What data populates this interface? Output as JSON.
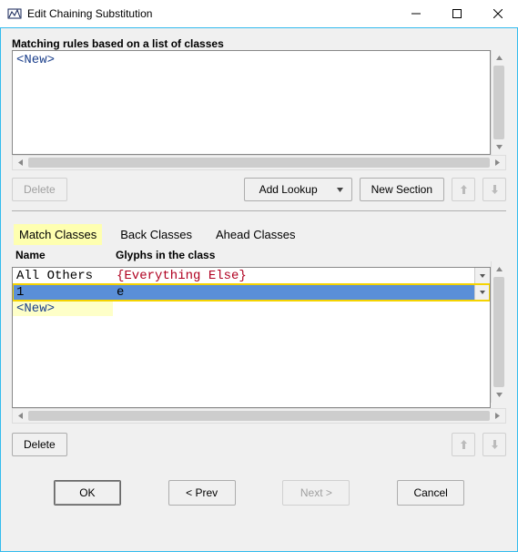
{
  "window": {
    "title": "Edit Chaining Substitution"
  },
  "rules": {
    "label": "Matching rules based on a list of classes",
    "new_placeholder": "<New>"
  },
  "toolbar": {
    "delete_label": "Delete",
    "add_lookup_label": "Add Lookup",
    "new_section_label": "New Section"
  },
  "tabs": {
    "match": "Match Classes",
    "back": "Back Classes",
    "ahead": "Ahead Classes"
  },
  "table": {
    "header_name": "Name",
    "header_glyphs": "Glyphs in the class",
    "rows": [
      {
        "name": "All Others",
        "glyphs": "{Everything Else}"
      },
      {
        "name": "1",
        "glyphs": "e"
      }
    ],
    "new_label": "<New>"
  },
  "toolbar2": {
    "delete_label": "Delete"
  },
  "footer": {
    "ok": "OK",
    "prev": "< Prev",
    "next": "Next >",
    "cancel": "Cancel"
  }
}
